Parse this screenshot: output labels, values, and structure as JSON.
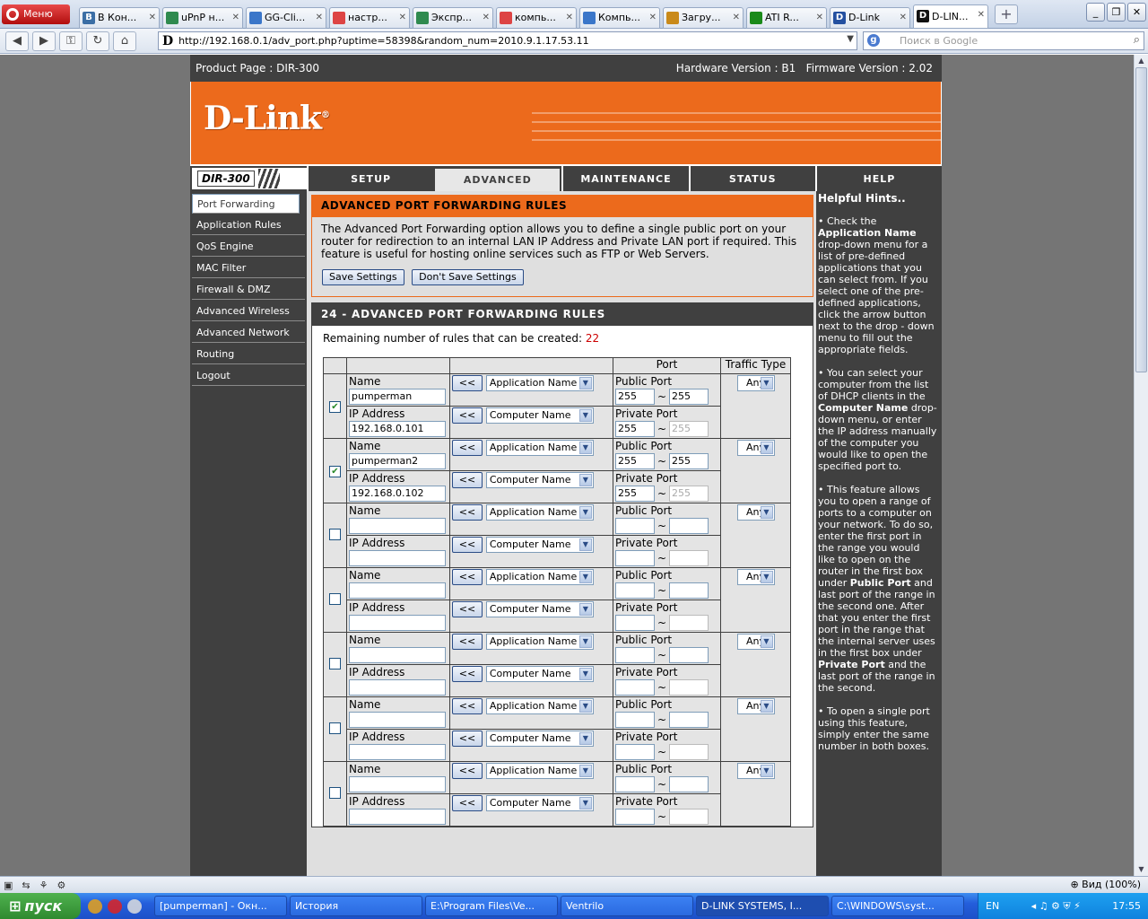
{
  "browser": {
    "menu_label": "Меню",
    "tabs": [
      {
        "label": "В Кон...",
        "fav": "В",
        "color": "#3b6ea5"
      },
      {
        "label": "uPnP н...",
        "fav": "",
        "color": "#2f8a4f"
      },
      {
        "label": "GG-Cli...",
        "fav": "",
        "color": "#3a76c9"
      },
      {
        "label": "настр...",
        "fav": "",
        "color": "#d44"
      },
      {
        "label": "Экспр...",
        "fav": "",
        "color": "#2f8a4f"
      },
      {
        "label": "компь...",
        "fav": "",
        "color": "#d44"
      },
      {
        "label": "Компь...",
        "fav": "",
        "color": "#3a76c9"
      },
      {
        "label": "Загру...",
        "fav": "",
        "color": "#c98a1a"
      },
      {
        "label": "ATI R...",
        "fav": "",
        "color": "#1a8a1a"
      },
      {
        "label": "D-Link",
        "fav": "D",
        "color": "#2450a0"
      },
      {
        "label": "D-LIN...",
        "fav": "D",
        "color": "#111"
      }
    ],
    "url": "http://192.168.0.1/adv_port.php?uptime=58398&random_num=2010.9.1.17.53.11",
    "search_placeholder": "Поиск в Google",
    "zoom": "Вид (100%)"
  },
  "router": {
    "product_label": "Product Page :  DIR-300",
    "hardware": "Hardware Version : B1",
    "firmware": "Firmware Version : 2.02",
    "logo": "D-Link",
    "model": "DIR-300",
    "nav_tabs": [
      "SETUP",
      "ADVANCED",
      "MAINTENANCE",
      "STATUS",
      "HELP"
    ],
    "active_tab": "ADVANCED",
    "left_nav": [
      "Port Forwarding",
      "Application Rules",
      "QoS Engine",
      "MAC Filter",
      "Firewall & DMZ",
      "Advanced Wireless",
      "Advanced Network",
      "Routing",
      "Logout"
    ],
    "section_title": "ADVANCED PORT FORWARDING RULES",
    "section_desc": "The Advanced Port Forwarding option allows you to define a single public port on your router for redirection to an internal LAN IP Address and Private LAN port if required. This feature is useful for hosting online services such as FTP or Web Servers.",
    "save_label": "Save Settings",
    "dont_save_label": "Don't Save Settings",
    "rules_title": "24 - ADVANCED PORT FORWARDING RULES",
    "remain_label": "Remaining number of rules that can be created:",
    "remain_count": "22",
    "hdr_port": "Port",
    "hdr_traffic": "Traffic Type",
    "lbl_name": "Name",
    "lbl_ip": "IP Address",
    "lbl_public": "Public Port",
    "lbl_private": "Private Port",
    "arrow_label": "<<",
    "app_name_option": "Application Name",
    "comp_name_option": "Computer Name",
    "traffic_option": "Any",
    "rules": [
      {
        "checked": true,
        "name": "pumperman",
        "ip": "192.168.0.101",
        "pub_start": "255",
        "pub_end": "255",
        "priv_start": "255",
        "priv_end": "255"
      },
      {
        "checked": true,
        "name": "pumperman2",
        "ip": "192.168.0.102",
        "pub_start": "255",
        "pub_end": "255",
        "priv_start": "255",
        "priv_end": "255"
      },
      {
        "checked": false,
        "name": "",
        "ip": "",
        "pub_start": "",
        "pub_end": "",
        "priv_start": "",
        "priv_end": ""
      },
      {
        "checked": false,
        "name": "",
        "ip": "",
        "pub_start": "",
        "pub_end": "",
        "priv_start": "",
        "priv_end": ""
      },
      {
        "checked": false,
        "name": "",
        "ip": "",
        "pub_start": "",
        "pub_end": "",
        "priv_start": "",
        "priv_end": ""
      },
      {
        "checked": false,
        "name": "",
        "ip": "",
        "pub_start": "",
        "pub_end": "",
        "priv_start": "",
        "priv_end": ""
      },
      {
        "checked": false,
        "name": "",
        "ip": "",
        "pub_start": "",
        "pub_end": "",
        "priv_start": "",
        "priv_end": ""
      }
    ],
    "hints_title": "Helpful Hints..",
    "hints": [
      [
        "• Check the ",
        "Application Name",
        " drop-down menu for a list of pre-defined applications that you can select from. If you select one of the pre-defined applications, click the arrow button next to the drop - down menu to fill out the appropriate fields."
      ],
      [
        "• You can select your computer from the list of DHCP clients in the ",
        "Computer Name",
        " drop-down menu, or enter the IP address manually of the computer you would like to open the specified port to."
      ],
      [
        "• This feature allows you to open a range of ports to a computer on your network. To do so, enter the first port in the range you would like to open on the router in the first box under ",
        "Public Port",
        " and last port of the range in the second one. After that you enter the first port in the range that the internal server uses in the first box under ",
        "Private Port",
        " and the last port of the range in the second."
      ],
      [
        "• To open a single port using this feature, simply enter the same number in both boxes."
      ]
    ]
  },
  "taskbar": {
    "start": "пуск",
    "tasks": [
      "[pumperman] - Окн...",
      "История",
      "E:\\Program Files\\Ve...",
      "Ventrilo",
      "D-LINK SYSTEMS, I...",
      "C:\\WINDOWS\\syst..."
    ],
    "lang": "EN",
    "clock": "17:55"
  }
}
